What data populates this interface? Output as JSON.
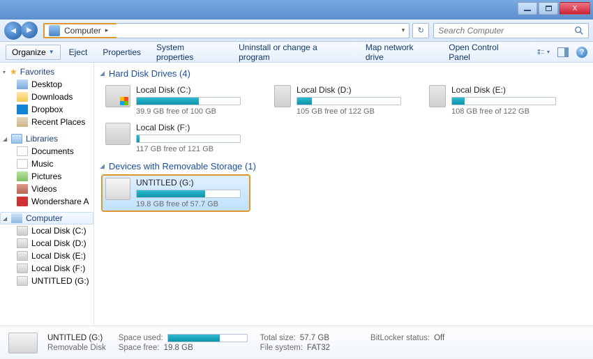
{
  "titlebar": {
    "close": "X"
  },
  "address": {
    "location": "Computer",
    "arrow": "▸"
  },
  "search": {
    "placeholder": "Search Computer"
  },
  "toolbar": {
    "organize": "Organize",
    "items": [
      "Eject",
      "Properties",
      "System properties",
      "Uninstall or change a program",
      "Map network drive",
      "Open Control Panel"
    ]
  },
  "sidebar": {
    "favorites": {
      "label": "Favorites",
      "items": [
        "Desktop",
        "Downloads",
        "Dropbox",
        "Recent Places"
      ]
    },
    "libraries": {
      "label": "Libraries",
      "items": [
        "Documents",
        "Music",
        "Pictures",
        "Videos",
        "Wondershare A"
      ]
    },
    "computer": {
      "label": "Computer",
      "items": [
        "Local Disk (C:)",
        "Local Disk (D:)",
        "Local Disk (E:)",
        "Local Disk (F:)",
        "UNTITLED (G:)"
      ]
    }
  },
  "groups": {
    "hdd": {
      "label": "Hard Disk Drives (4)"
    },
    "removable": {
      "label": "Devices with Removable Storage (1)"
    }
  },
  "drives": {
    "c": {
      "name": "Local Disk (C:)",
      "free": "39.9 GB free of 100 GB",
      "pct": 60
    },
    "d": {
      "name": "Local Disk (D:)",
      "free": "105 GB free of 122 GB",
      "pct": 14
    },
    "e": {
      "name": "Local Disk (E:)",
      "free": "108 GB free of 122 GB",
      "pct": 12
    },
    "f": {
      "name": "Local Disk (F:)",
      "free": "117 GB free of 121 GB",
      "pct": 3
    },
    "g": {
      "name": "UNTITLED (G:)",
      "free": "19.8 GB free of 57.7 GB",
      "pct": 66
    }
  },
  "details": {
    "name": "UNTITLED (G:)",
    "type": "Removable Disk",
    "space_used_label": "Space used:",
    "space_free_label": "Space free:",
    "space_free": "19.8 GB",
    "total_size_label": "Total size:",
    "total_size": "57.7 GB",
    "fs_label": "File system:",
    "fs": "FAT32",
    "bitlocker_label": "BitLocker status:",
    "bitlocker": "Off",
    "used_pct": 66
  }
}
